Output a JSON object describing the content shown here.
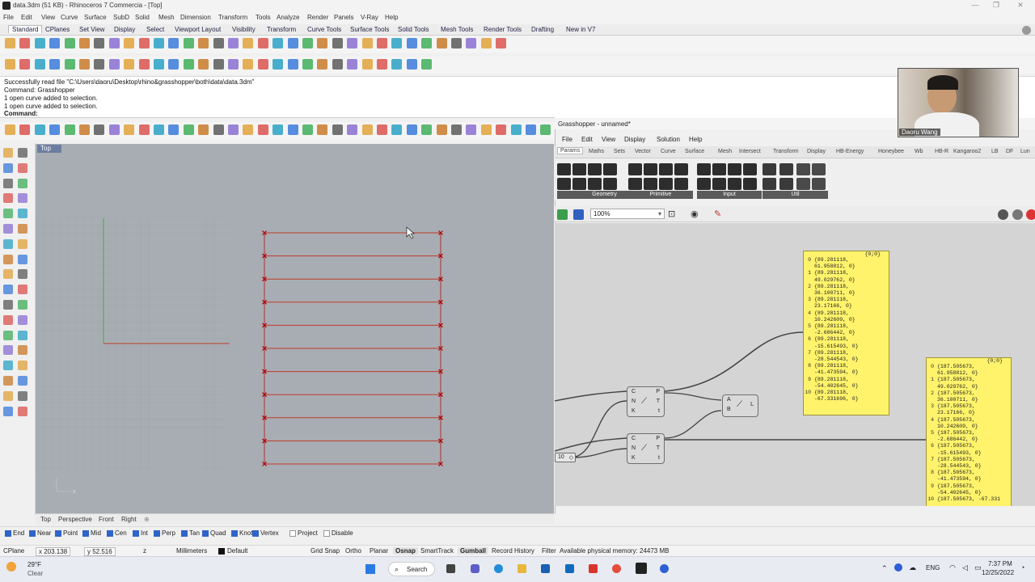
{
  "window": {
    "title": "data.3dm (51 KB) - Rhinoceros 7 Commercia - [Top]"
  },
  "menu": [
    "File",
    "Edit",
    "View",
    "Curve",
    "Surface",
    "SubD",
    "Solid",
    "Mesh",
    "Dimension",
    "Transform",
    "Tools",
    "Analyze",
    "Render",
    "Panels",
    "V-Ray",
    "Help"
  ],
  "toolbar_tabs": [
    "Standard",
    "CPlanes",
    "Set View",
    "Display",
    "Select",
    "Viewport Layout",
    "Visibility",
    "Transform",
    "Curve Tools",
    "Surface Tools",
    "Solid Tools",
    "Mesh Tools",
    "Render Tools",
    "Drafting",
    "New in V7"
  ],
  "command_history": [
    "Successfully read file \"C:\\Users\\daoru\\Desktop\\rhino&grasshopper\\both\\data\\data.3dm\"",
    "Command: Grasshopper",
    "1 open curve added to selection.",
    "1 open curve added to selection."
  ],
  "command_prompt": "Command:",
  "viewport": {
    "name": "Top",
    "tabs": [
      "Top",
      "Perspective",
      "Front",
      "Right"
    ],
    "add_tab_icon": "plus-icon"
  },
  "osnap": [
    {
      "label": "End",
      "checked": true
    },
    {
      "label": "Near",
      "checked": true
    },
    {
      "label": "Point",
      "checked": true
    },
    {
      "label": "Mid",
      "checked": true
    },
    {
      "label": "Cen",
      "checked": true
    },
    {
      "label": "Int",
      "checked": true
    },
    {
      "label": "Perp",
      "checked": true
    },
    {
      "label": "Tan",
      "checked": true
    },
    {
      "label": "Quad",
      "checked": true
    },
    {
      "label": "Knot",
      "checked": true
    },
    {
      "label": "Vertex",
      "checked": true
    },
    {
      "label": "Project",
      "checked": false
    },
    {
      "label": "Disable",
      "checked": false
    }
  ],
  "status": {
    "cplane": "CPlane",
    "x": "x 203.138",
    "y": "y 52.516",
    "z": "z",
    "units": "Millimeters",
    "layer": "Default",
    "toggles": [
      "Grid Snap",
      "Ortho",
      "Planar",
      "Osnap",
      "SmartTrack",
      "Gumball",
      "Record History",
      "Filter"
    ],
    "memory": "Available physical memory: 24473 MB"
  },
  "webcam": {
    "name": "Daoru Wang"
  },
  "grasshopper": {
    "title": "Grasshopper - unnamed*",
    "menu": [
      "File",
      "Edit",
      "View",
      "Display",
      "Solution",
      "Help"
    ],
    "tabs": [
      "Params",
      "Maths",
      "Sets",
      "Vector",
      "Curve",
      "Surface",
      "Mesh",
      "Intersect",
      "Transform",
      "Display",
      "HB-Energy",
      "Honeybee",
      "Wb",
      "HB-R",
      "Kangaroo2",
      "LB",
      "DF",
      "Lun"
    ],
    "groups": [
      "Geometry",
      "Primitive",
      "Input",
      "Util"
    ],
    "zoom": "100%",
    "panel1": {
      "header": "{0;0}",
      "items": [
        "{89.281118, 61.958812, 0}",
        "{89.281118, 49.029762, 0}",
        "{89.281118, 36.100711, 0}",
        "{89.281118, 23.17166, 0}",
        "{89.281118, 10.242609, 0}",
        "{89.281118, -2.686442, 0}",
        "{89.281118, -15.615493, 0}",
        "{89.281118, -28.544543, 0}",
        "{89.281118, -41.473594, 0}",
        "{89.281118, -54.402645, 0}",
        "{89.281118, -67.331696, 0}"
      ]
    },
    "panel2": {
      "header": "{0;0}",
      "items": [
        "{187.505673, 61.958812, 0}",
        "{187.505673, 49.029762, 0}",
        "{187.505673, 36.100711, 0}",
        "{187.505673, 23.17166, 0}",
        "{187.505673, 10.242609, 0}",
        "{187.505673, -2.686442, 0}",
        "{187.505673, -15.615493, 0}",
        "{187.505673, -28.544543, 0}",
        "{187.505673, -41.473594, 0}",
        "{187.505673, -54.402645, 0}",
        "{187.505673, -67.331"
      ]
    },
    "divide1": {
      "inputs": [
        "C",
        "N",
        "K"
      ],
      "outputs": [
        "P",
        "T",
        "t"
      ]
    },
    "divide2": {
      "inputs": [
        "C",
        "N",
        "K"
      ],
      "outputs": [
        "P",
        "T",
        "t"
      ]
    },
    "line": {
      "inputs": [
        "A",
        "B"
      ],
      "output": "L"
    },
    "slider": {
      "value": "10"
    }
  },
  "taskbar": {
    "weather_temp": "29°F",
    "weather_desc": "Clear",
    "search": "Search",
    "lang": "ENG",
    "time": "7:37 PM",
    "date": "12/25/2022"
  }
}
